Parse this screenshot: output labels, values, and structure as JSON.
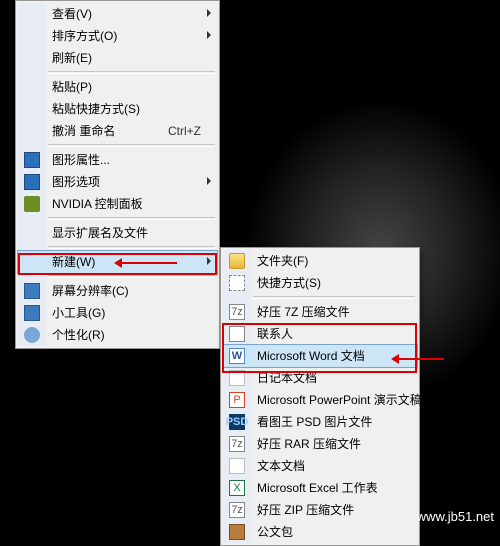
{
  "watermark": "www.jb51.net",
  "menu1": {
    "groups": [
      [
        {
          "label": "查看(V)",
          "icon": "",
          "sub": true
        },
        {
          "label": "排序方式(O)",
          "icon": "",
          "sub": true
        },
        {
          "label": "刷新(E)",
          "icon": ""
        }
      ],
      [
        {
          "label": "粘贴(P)",
          "icon": ""
        },
        {
          "label": "粘贴快捷方式(S)",
          "icon": ""
        },
        {
          "label": "撤消 重命名",
          "icon": "",
          "shortcut": "Ctrl+Z"
        }
      ],
      [
        {
          "label": "图形属性...",
          "icon": "gpu"
        },
        {
          "label": "图形选项",
          "icon": "gpu",
          "sub": true
        },
        {
          "label": "NVIDIA 控制面板",
          "icon": "nv"
        }
      ],
      [
        {
          "label": "显示扩展名及文件",
          "icon": ""
        }
      ],
      [
        {
          "label": "新建(W)",
          "icon": "",
          "sub": true,
          "hov": true,
          "anchor": "src"
        }
      ],
      [
        {
          "label": "屏幕分辨率(C)",
          "icon": "mon"
        },
        {
          "label": "小工具(G)",
          "icon": "mon"
        },
        {
          "label": "个性化(R)",
          "icon": "gear"
        }
      ]
    ]
  },
  "menu2": {
    "groups": [
      [
        {
          "label": "文件夹(F)",
          "icon": "folder"
        },
        {
          "label": "快捷方式(S)",
          "icon": "short"
        }
      ],
      [
        {
          "label": "好压 7Z 压缩文件",
          "icon": "7z"
        },
        {
          "label": "联系人",
          "icon": "contact"
        },
        {
          "label": "Microsoft Word 文档",
          "icon": "doc",
          "hov": true,
          "anchor": "dst"
        },
        {
          "label": "日记本文档",
          "icon": "txt"
        },
        {
          "label": "Microsoft PowerPoint 演示文稿",
          "icon": "ppt"
        },
        {
          "label": "看图王 PSD 图片文件",
          "icon": "psd"
        },
        {
          "label": "好压 RAR 压缩文件",
          "icon": "7z"
        },
        {
          "label": "文本文档",
          "icon": "txt"
        },
        {
          "label": "Microsoft Excel 工作表",
          "icon": "xl"
        },
        {
          "label": "好压 ZIP 压缩文件",
          "icon": "7z"
        },
        {
          "label": "公文包",
          "icon": "brief"
        }
      ]
    ]
  },
  "icon_glyphs": {
    "7z": "7z",
    "doc": "W",
    "ppt": "P",
    "psd": "PSD",
    "xl": "X"
  }
}
